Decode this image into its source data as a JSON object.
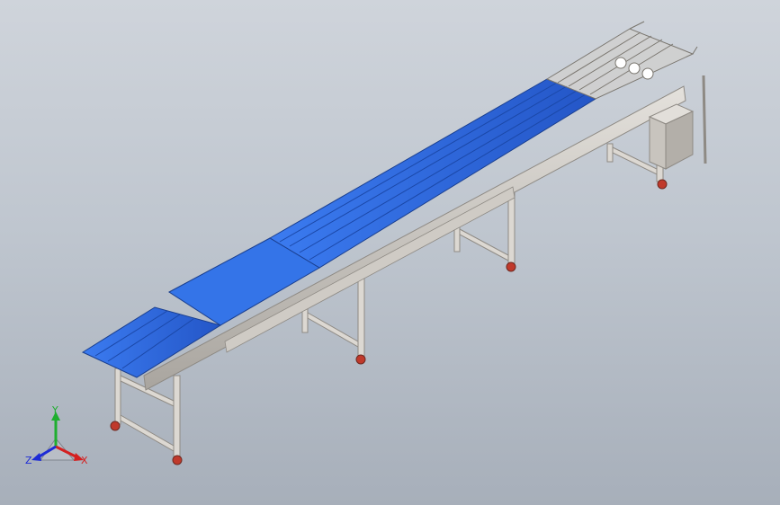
{
  "triad": {
    "x_label": "X",
    "y_label": "Y",
    "z_label": "Z",
    "x_color": "#d42020",
    "y_color": "#1fae2f",
    "z_color": "#1d2bd6"
  },
  "colors": {
    "belt": "#2f6fe0",
    "belt_dark": "#1f4fb0",
    "frame": "#d9d5cf",
    "frame_shadow": "#9a968f",
    "caster": "#c0392b"
  }
}
